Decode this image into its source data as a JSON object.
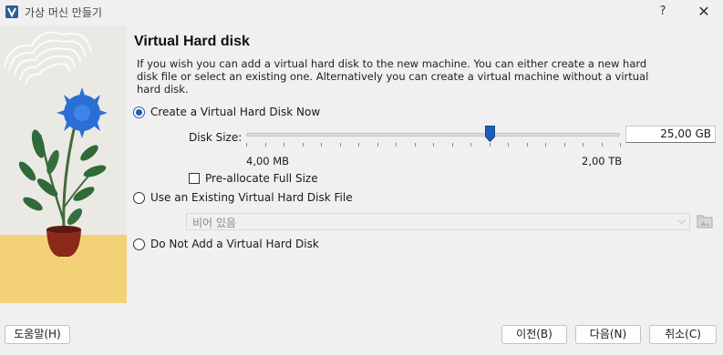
{
  "window": {
    "title": "가상 머신 만들기",
    "help_label": "?",
    "close_label": "✕"
  },
  "page": {
    "heading": "Virtual Hard disk",
    "description": "If you wish you can add a virtual hard disk to the new machine. You can either create a new hard disk file or select an existing one. Alternatively you can create a virtual machine without a virtual hard disk."
  },
  "options": {
    "create_new": {
      "label": "Create a Virtual Hard Disk Now",
      "selected": true
    },
    "use_existing": {
      "label": "Use an Existing Virtual Hard Disk File",
      "selected": false
    },
    "do_not_add": {
      "label": "Do Not Add a Virtual Hard Disk",
      "selected": false
    }
  },
  "disk_size": {
    "label": "Disk Size:",
    "value": "25,00 GB",
    "slider_fraction": 0.65,
    "min_label": "4,00 MB",
    "max_label": "2,00 TB"
  },
  "preallocate": {
    "label": "Pre-allocate Full Size",
    "checked": false
  },
  "existing_file": {
    "value": "비어 있음"
  },
  "buttons": {
    "help": "도움말(H)",
    "back": "이전(B)",
    "next": "다음(N)",
    "cancel": "취소(C)"
  },
  "colors": {
    "accent": "#1a5fb4",
    "flower": "#2b6ed6",
    "pot": "#8b2a1a",
    "ground": "#f3d277"
  }
}
